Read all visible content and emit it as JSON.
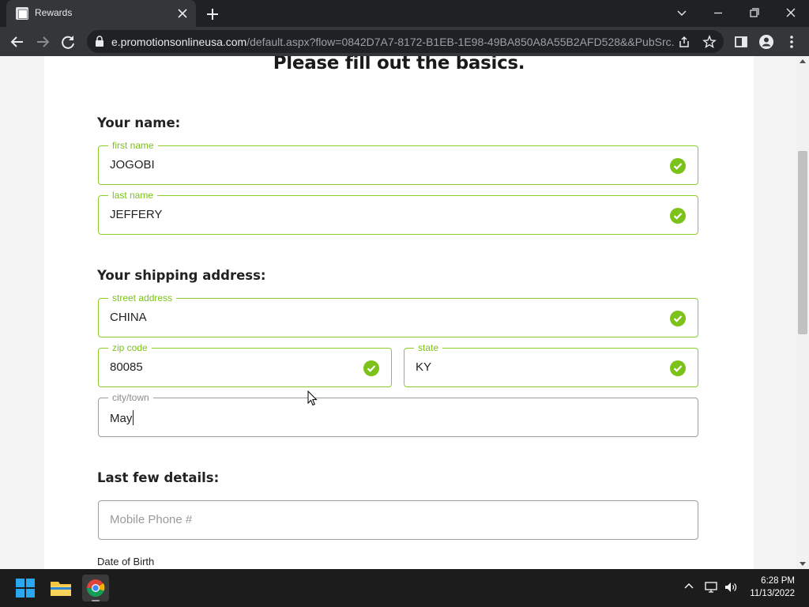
{
  "browser": {
    "tab_title": "Rewards",
    "url_host": "e.promotionsonlineusa.com",
    "url_path": "/default.aspx?flow=0842D7A7-8172-B1EB-1E98-49BA850A8A55B2AFD528&&PubSrc..."
  },
  "page": {
    "title": "Please fill out the basics.",
    "sections": {
      "name": "Your name:",
      "shipping": "Your shipping address:",
      "details": "Last few details:"
    },
    "fields": {
      "first_name": {
        "label": "first name",
        "value": "JOGOBI"
      },
      "last_name": {
        "label": "last name",
        "value": "JEFFERY"
      },
      "street_address": {
        "label": "street address",
        "value": "CHINA"
      },
      "zip_code": {
        "label": "zip code",
        "value": "80085"
      },
      "state": {
        "label": "state",
        "value": "KY"
      },
      "city": {
        "label": "city/town",
        "value": "May"
      },
      "mobile_phone": {
        "placeholder": "Mobile Phone #"
      }
    },
    "dob_label": "Date of Birth"
  },
  "colors": {
    "valid_border": "#8ccc2a",
    "check_green": "#7cc21a"
  },
  "taskbar": {
    "time": "6:28 PM",
    "date": "11/13/2022"
  }
}
